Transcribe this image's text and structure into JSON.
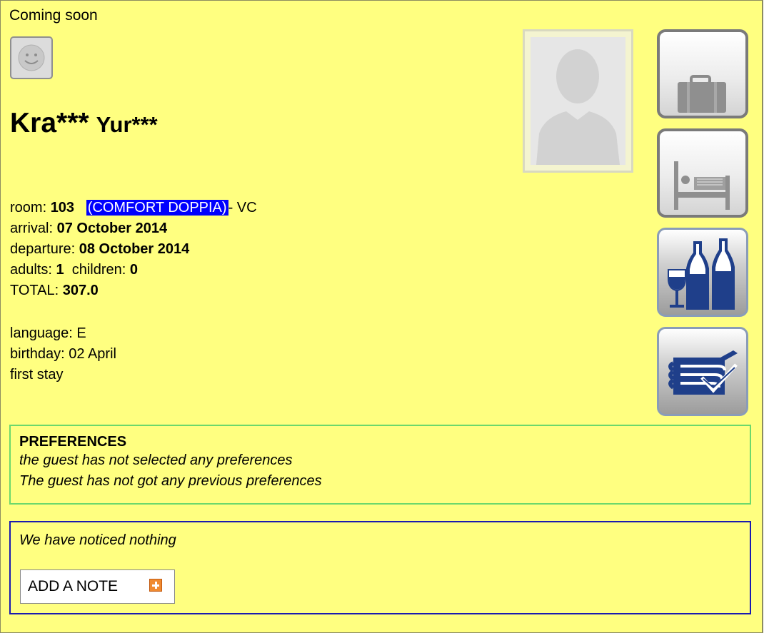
{
  "header": {
    "status": "Coming soon"
  },
  "guest": {
    "last_name": "Kra***",
    "first_name": "Yur***",
    "room_label": "room: ",
    "room_number": "103",
    "room_type": "(COMFORT DOPPIA)",
    "room_suffix": "- VC",
    "arrival_label": "arrival: ",
    "arrival": "07 October 2014",
    "departure_label": "departure: ",
    "departure": "08 October 2014",
    "adults_label": "adults: ",
    "adults": "1",
    "children_label": "children: ",
    "children": "0",
    "total_label": "TOTAL: ",
    "total": "307.0",
    "language_label": "language: ",
    "language": "E",
    "birthday": "birthday: 02 April",
    "stay": "first stay"
  },
  "icons": {
    "mood": "smiley-icon",
    "photo": "avatar-placeholder",
    "tiles": [
      "luggage-icon",
      "bed-icon",
      "wine-bottles-icon",
      "towels-icon"
    ]
  },
  "preferences": {
    "title": "PREFERENCES",
    "line1": "the guest has not selected any preferences",
    "line2": "The guest has not got any previous preferences"
  },
  "notes": {
    "message": "We have noticed nothing",
    "add_label": "ADD A NOTE"
  },
  "colors": {
    "background": "#ffff80",
    "room_type_highlight": "#0000ff",
    "preferences_border": "#6cd86c",
    "notes_border": "#1a1ab0",
    "tile_blue": "#1f3f8a"
  }
}
